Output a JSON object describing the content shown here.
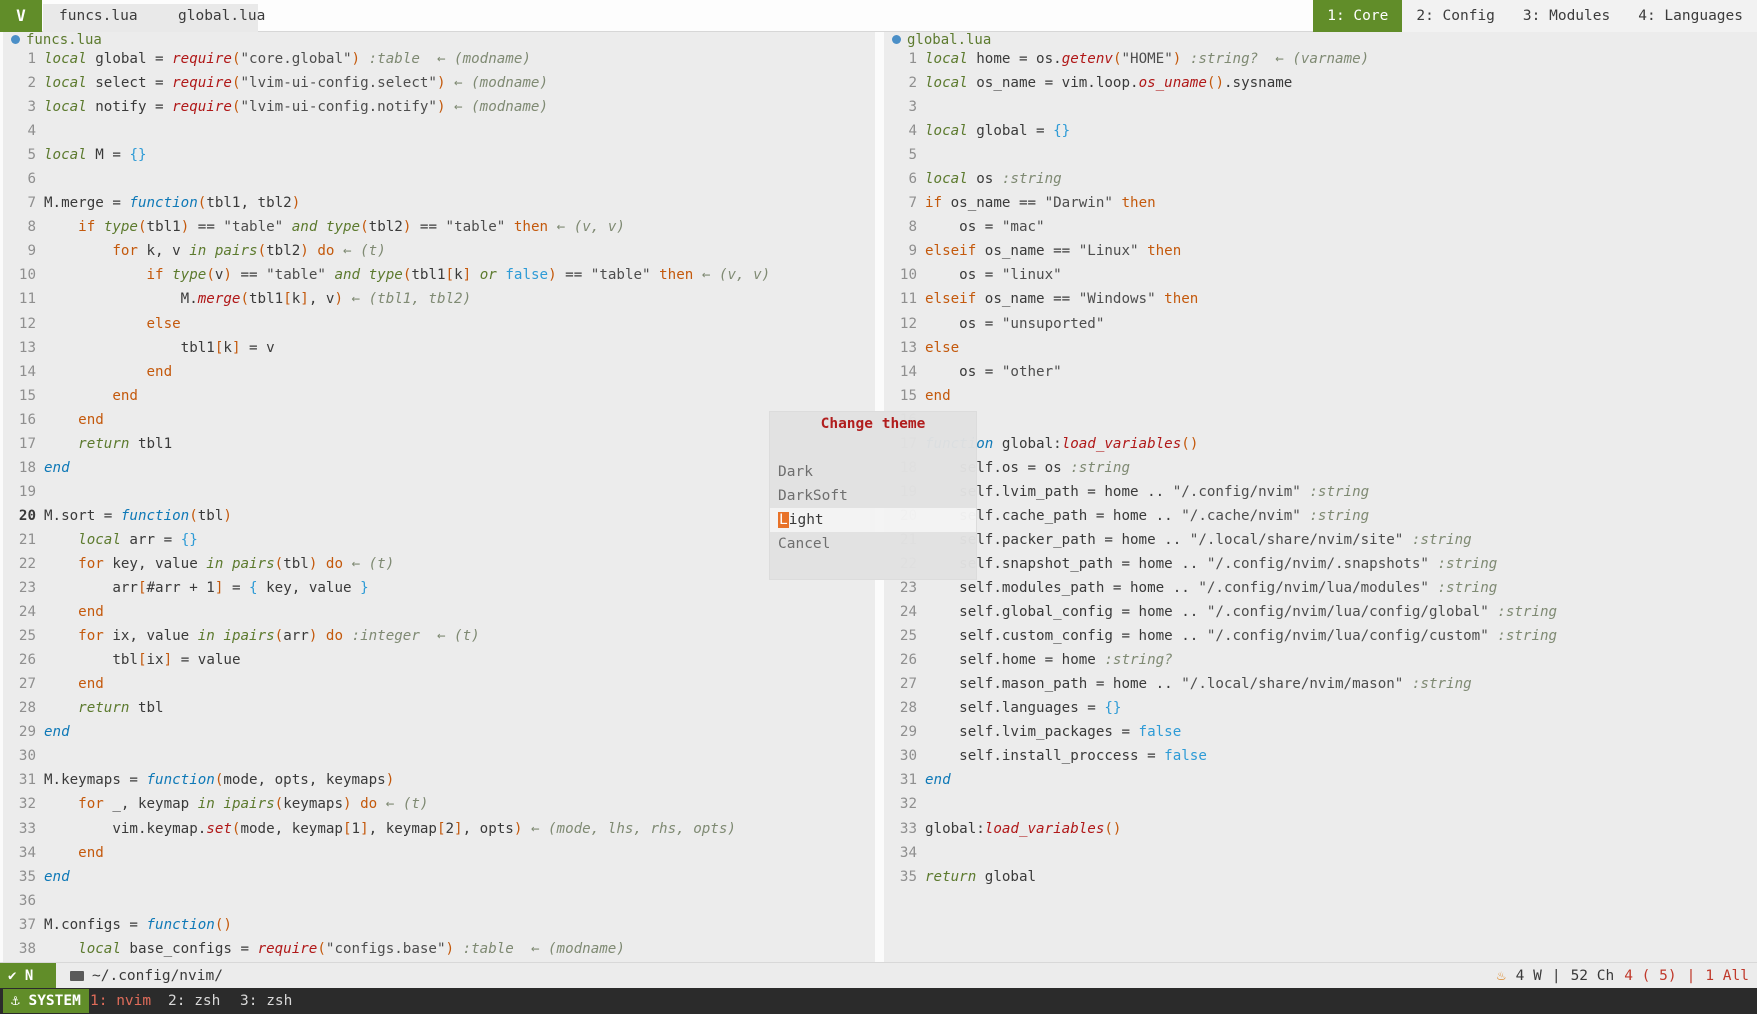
{
  "tabline": {
    "logo": "V",
    "buffers": [
      "funcs.lua",
      "global.lua"
    ],
    "workspaces": [
      "1: Core",
      "2: Config",
      "3: Modules",
      "4: Languages"
    ]
  },
  "left": {
    "filename": "funcs.lua"
  },
  "right": {
    "filename": "global.lua"
  },
  "picker": {
    "title": "Change theme",
    "options": [
      "Dark",
      "DarkSoft",
      "Light",
      "Cancel"
    ],
    "selected": "Light"
  },
  "statusline": {
    "mode": "N",
    "cwd": "~/.config/nvim/",
    "words": "4 W",
    "chars": "52 Ch",
    "position": "4 (  5)",
    "scroll": "1 All"
  },
  "tmux": {
    "session": "SYSTEM",
    "windows": [
      "1: nvim",
      "2: zsh",
      "3: zsh"
    ]
  },
  "colors": {
    "accent": "#618d29",
    "error": "#c0392b",
    "function": "#0f79b7"
  }
}
